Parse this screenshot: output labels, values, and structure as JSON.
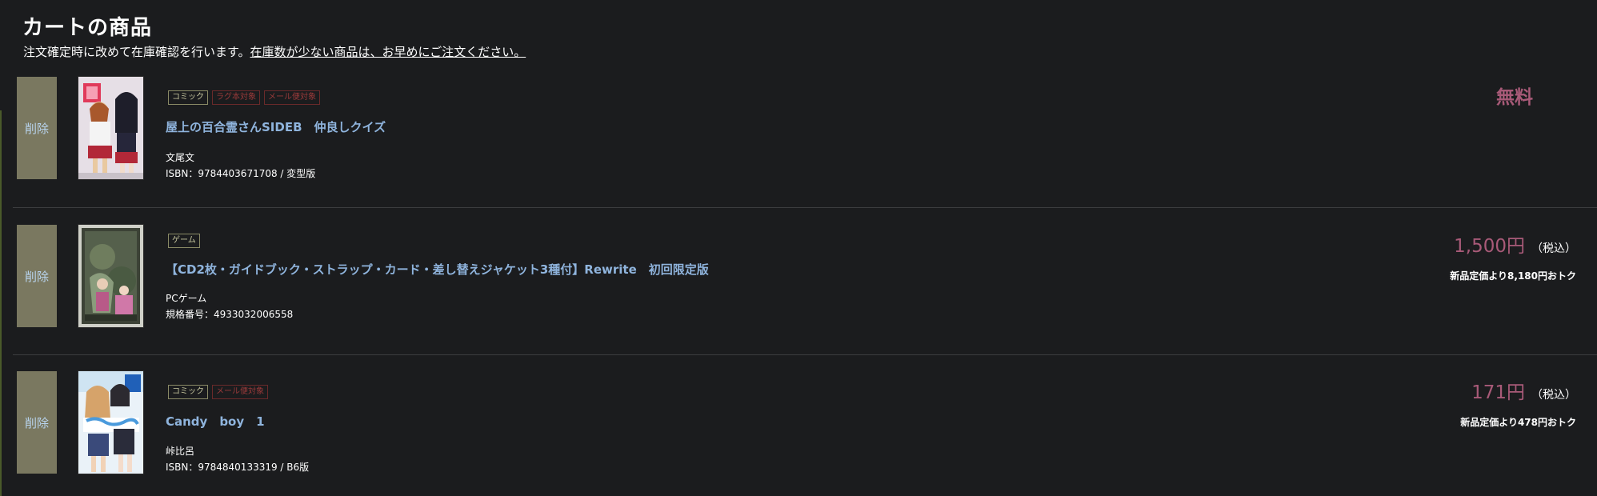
{
  "cart": {
    "title": "カートの商品",
    "notice_text": "注文確定時に改めて在庫確認を行います。",
    "notice_link": "在庫数が少ない商品は、お早めにご注文ください。"
  },
  "items": [
    {
      "delete_label": "削除",
      "tags": [
        "コミック",
        "ラグ本対象",
        "メール便対象"
      ],
      "title": "屋上の百合霊さんSIDEB　仲良しクイズ",
      "author": "文尾文",
      "code": "ISBN：9784403671708 / 変型版",
      "price": "無料",
      "thumb_icon": "comic-cover-thumbnail"
    },
    {
      "delete_label": "削除",
      "tags": [
        "ゲーム"
      ],
      "title": "【CD2枚・ガイドブック・ストラップ・カード・差し替えジャケット3種付】Rewrite　初回限定版",
      "author": "PCゲーム",
      "code": "規格番号：4933032006558",
      "price": "1,500円",
      "tax": "（税込）",
      "saving": "新品定価より8,180円おトク",
      "thumb_icon": "game-box-thumbnail"
    },
    {
      "delete_label": "削除",
      "tags": [
        "コミック",
        "メール便対象"
      ],
      "title": "Candy　boy　1",
      "author": "峠比呂",
      "code": "ISBN：9784840133319 / B6版",
      "price": "171円",
      "tax": "（税込）",
      "saving": "新品定価より478円おトク",
      "thumb_icon": "comic-cover-thumbnail"
    }
  ],
  "colors": {
    "background": "#1b1c1e",
    "delete_button": "#7a7860",
    "title_link": "#8fb4dd",
    "price": "#a85a78"
  }
}
